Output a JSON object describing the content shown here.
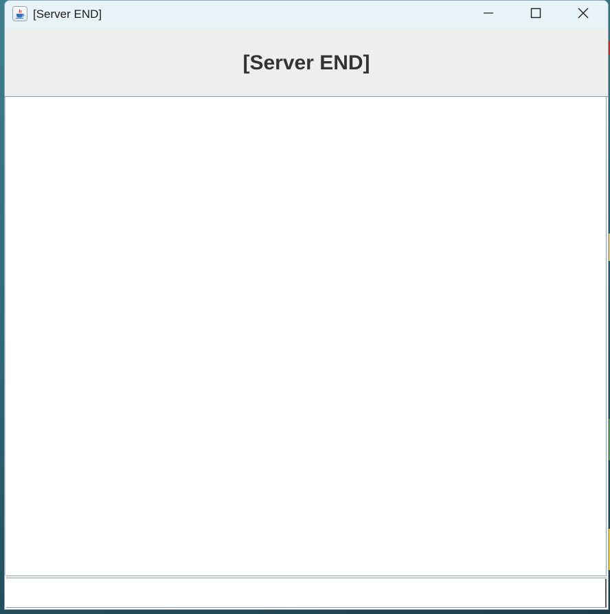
{
  "window": {
    "title": "[Server END]",
    "app_icon": "java-coffee-cup-icon",
    "controls": {
      "minimize_icon": "minimize-icon",
      "maximize_icon": "maximize-icon",
      "close_icon": "close-icon"
    }
  },
  "header": {
    "title": "[Server END]"
  },
  "log": {
    "content": ""
  },
  "message_input": {
    "value": "",
    "placeholder": ""
  },
  "colors": {
    "titlebar_bg": "#e8f3f7",
    "header_bg": "#eeeeee",
    "header_text": "#333333",
    "content_bg": "#ffffff"
  }
}
